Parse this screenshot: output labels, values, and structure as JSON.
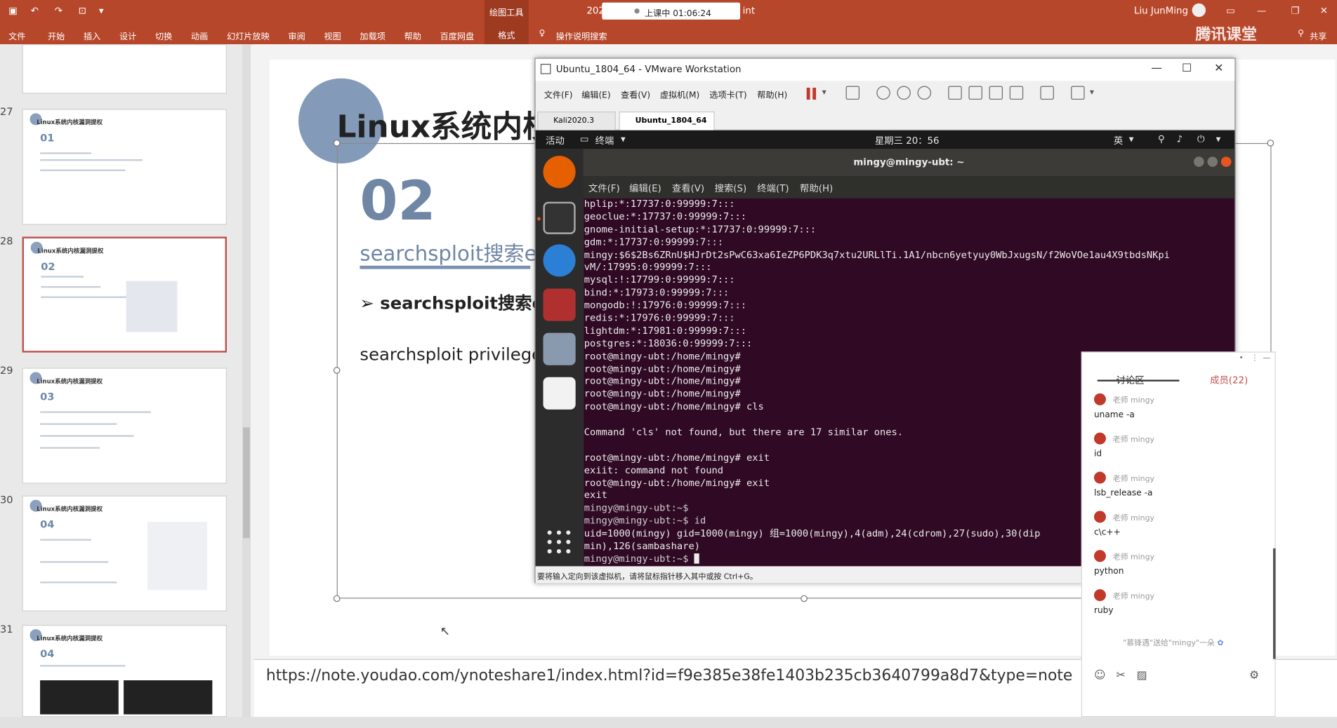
{
  "ppt": {
    "account": "Liu JunMing",
    "live_badge": "上课中 01:06:24",
    "title_fragment_left": "202",
    "title_fragment_right": "int",
    "tabs": [
      "文件",
      "开始",
      "插入",
      "设计",
      "切换",
      "动画",
      "幻灯片放映",
      "审阅",
      "视图",
      "加载项",
      "帮助",
      "百度网盘"
    ],
    "drawing_tools": "绘图工具",
    "format_tab": "格式",
    "tell_me": "操作说明搜索",
    "share": "共享",
    "brand": "腾讯课堂"
  },
  "thumbnails": [
    {
      "num": "27",
      "title": "Linux系统内核漏洞提权",
      "sub": "01"
    },
    {
      "num": "28",
      "title": "Linux系统内核漏洞提权",
      "sub": "02"
    },
    {
      "num": "29",
      "title": "Linux系统内核漏洞提权",
      "sub": "03"
    },
    {
      "num": "30",
      "title": "Linux系统内核漏洞提权",
      "sub": "04"
    },
    {
      "num": "31",
      "title": "Linux系统内核漏洞提权",
      "sub": "04"
    }
  ],
  "slide": {
    "title": "Linux系统内核",
    "section_number": "02",
    "subtitle": "searchsploit搜索e",
    "bullet": "searchsploit搜索e",
    "text": "searchsploit privilege"
  },
  "notes": "https://note.youdao.com/ynoteshare1/index.html?id=f9e385e38fe1403b235cb3640799a8d7&type=note",
  "vmware": {
    "title": "Ubuntu_1804_64 - VMware Workstation",
    "menu": [
      "文件(F)",
      "编辑(E)",
      "查看(V)",
      "虚拟机(M)",
      "选项卡(T)",
      "帮助(H)"
    ],
    "tabs": [
      "Kali2020.3",
      "Ubuntu_1804_64"
    ],
    "status": "要将输入定向到该虚拟机，请将鼠标指针移入其中或按 Ctrl+G。"
  },
  "ubuntu": {
    "activities": "活动",
    "terminal_app": "终端",
    "clock": "星期三 20：56",
    "lang": "英",
    "window_title": "mingy@mingy-ubt: ~",
    "menu": [
      "文件(F)",
      "编辑(E)",
      "查看(V)",
      "搜索(S)",
      "终端(T)",
      "帮助(H)"
    ]
  },
  "terminal_lines": [
    "hplip:*:17737:0:99999:7:::",
    "geoclue:*:17737:0:99999:7:::",
    "gnome-initial-setup:*:17737:0:99999:7:::",
    "gdm:*:17737:0:99999:7:::",
    "mingy:$6$2Bs6ZRnU$HJrDt2sPwC63xa6IeZP6PDK3q7xtu2URLlTi.1A1/nbcn6yetyuy0WbJxugsN/f2WoVOe1au4X9tbdsNKpi",
    "vM/:17995:0:99999:7:::",
    "mysql:!:17799:0:99999:7:::",
    "bind:*:17973:0:99999:7:::",
    "mongodb:!:17976:0:99999:7:::",
    "redis:*:17976:0:99999:7:::",
    "lightdm:*:17981:0:99999:7:::",
    "postgres:*:18036:0:99999:7:::",
    "root@mingy-ubt:/home/mingy#",
    "root@mingy-ubt:/home/mingy#",
    "root@mingy-ubt:/home/mingy#",
    "root@mingy-ubt:/home/mingy#",
    "root@mingy-ubt:/home/mingy# cls",
    "",
    "Command 'cls' not found, but there are 17 similar ones.",
    "",
    "root@mingy-ubt:/home/mingy# exit",
    "exiit: command not found",
    "root@mingy-ubt:/home/mingy# exit",
    "exit",
    "mingy@mingy-ubt:~$",
    "mingy@mingy-ubt:~$ id",
    "uid=1000(mingy) gid=1000(mingy) 组=1000(mingy),4(adm),24(cdrom),27(sudo),30(dip",
    "min),126(sambashare)",
    "mingy@mingy-ubt:~$ "
  ],
  "discussion": {
    "tab": "讨论区",
    "members": "成员(22)",
    "sender": "老师  mingy",
    "messages": [
      "uname -a",
      "id",
      "lsb_release -a",
      "c\\c++",
      "python",
      "ruby"
    ],
    "note": "\"慕锋遇\"送给\"mingy\"一朵"
  },
  "colors": {
    "ribbon": "#b7472a",
    "terminal_bg": "#300a24",
    "slide_accent": "#6f86a5"
  }
}
